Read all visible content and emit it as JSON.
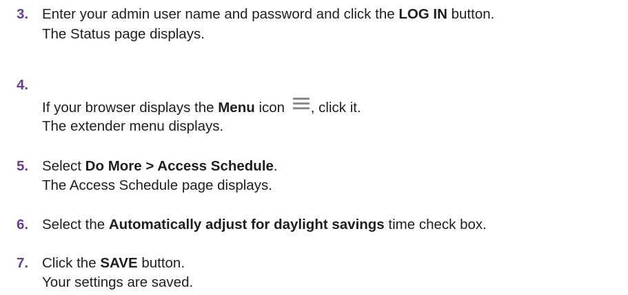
{
  "steps": [
    {
      "number": "3.",
      "line1": {
        "t1": "Enter your admin user name and password and click the ",
        "b1": "LOG IN",
        "t2": " button."
      },
      "line2": "The Status page displays."
    },
    {
      "number": "4.",
      "line1": {
        "t1": "If your browser displays the ",
        "b1": "Menu",
        "t2": " icon ",
        "icon": "hamburger-menu-icon",
        "t3": ", click it."
      },
      "line2": "The extender menu displays."
    },
    {
      "number": "5.",
      "line1": {
        "t1": "Select ",
        "b1": "Do More > Access Schedule",
        "t2": "."
      },
      "line2": "The Access Schedule page displays."
    },
    {
      "number": "6.",
      "line1": {
        "t1": "Select the ",
        "b1": "Automatically adjust for daylight savings",
        "t2": " time check box."
      }
    },
    {
      "number": "7.",
      "line1": {
        "t1": "Click the ",
        "b1": "SAVE",
        "t2": " button."
      },
      "line2": "Your settings are saved."
    }
  ],
  "colors": {
    "step_number": "#6b3d8f",
    "text": "#1e1e1e",
    "icon": "#8c8c8c"
  }
}
